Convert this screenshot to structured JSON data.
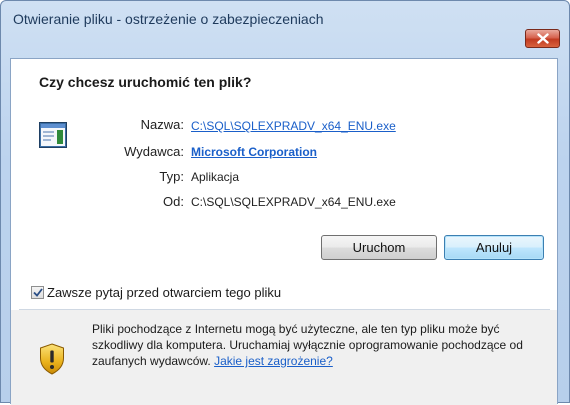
{
  "window": {
    "title": "Otwieranie pliku - ostrzeżenie o zabezpieczeniach"
  },
  "dialog": {
    "question": "Czy chcesz uruchomić ten plik?",
    "fields": {
      "name_label": "Nazwa:",
      "name_value": "C:\\SQL\\SQLEXPRADV_x64_ENU.exe",
      "publisher_label": "Wydawca:",
      "publisher_value": "Microsoft Corporation",
      "type_label": "Typ:",
      "type_value": "Aplikacja",
      "from_label": "Od:",
      "from_value": "C:\\SQL\\SQLEXPRADV_x64_ENU.exe"
    },
    "buttons": {
      "run_label": "Uruchom",
      "cancel_label": "Anuluj"
    },
    "checkbox": {
      "label": "Zawsze pytaj przed otwarciem tego pliku",
      "checked": true
    },
    "warning": {
      "text": "Pliki pochodzące z Internetu mogą być użyteczne, ale ten typ pliku może być szkodliwy dla komputera. Uruchamiaj wyłącznie oprogramowanie pochodzące od zaufanych wydawców.",
      "link_label": "Jakie jest zagrożenie?"
    }
  },
  "icons": {
    "close": "close-icon",
    "application": "application-icon",
    "shield": "security-shield-icon",
    "check": "checkmark-icon"
  },
  "colors": {
    "link": "#1a5fc9",
    "close_button": "#c23b21",
    "title_bar": "#bcd3ee",
    "warning_panel": "#f0f0f0"
  }
}
